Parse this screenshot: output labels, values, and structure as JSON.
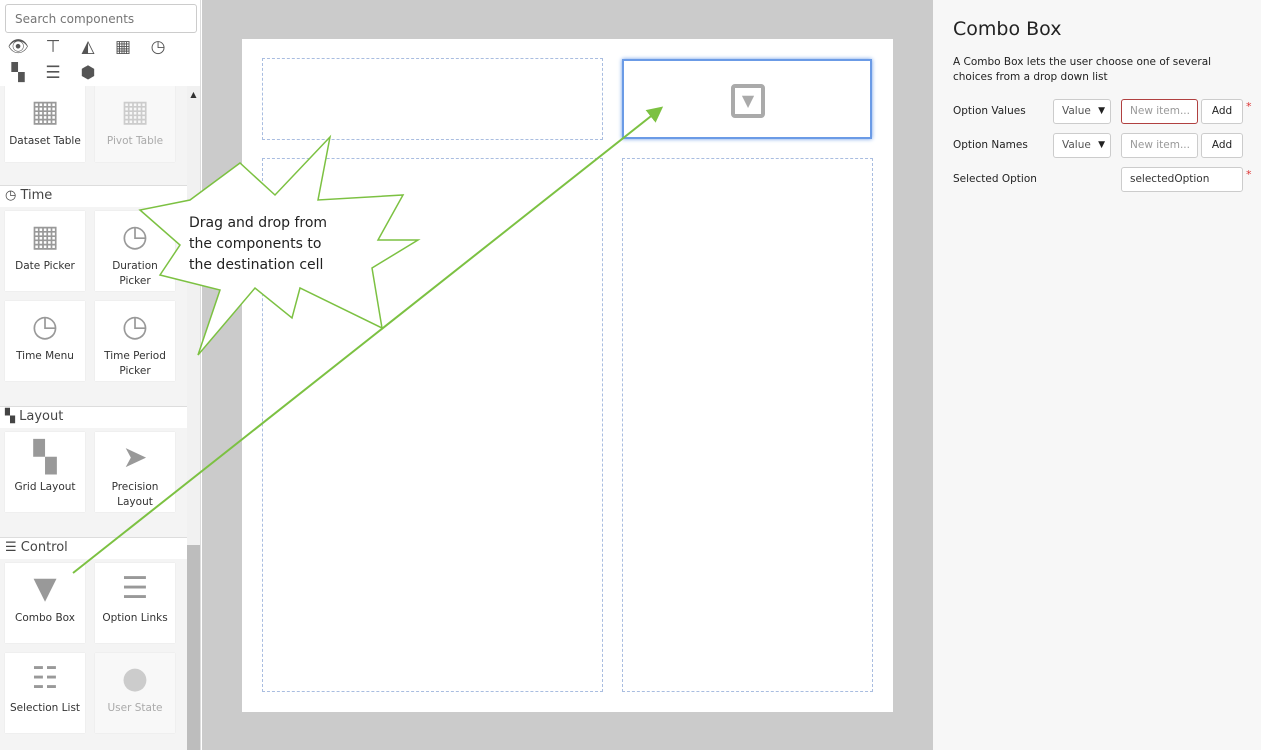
{
  "sidebar": {
    "search_placeholder": "Search components",
    "categories": [
      "eye-icon",
      "hierarchy-icon",
      "area-chart-icon",
      "table-icon",
      "clock-icon",
      "grid-icon",
      "sliders-icon",
      "cube-icon"
    ],
    "sections": {
      "time": "Time",
      "layout": "Layout",
      "control": "Control"
    },
    "tiles": {
      "dataset_table": "Dataset Table",
      "pivot_table": "Pivot Table",
      "date_picker": "Date Picker",
      "duration_picker": "Duration Picker",
      "time_menu": "Time Menu",
      "time_period_picker": "Time Period Picker",
      "grid_layout": "Grid Layout",
      "precision_layout": "Precision Layout",
      "combo_box": "Combo Box",
      "option_links": "Option Links",
      "selection_list": "Selection List",
      "user_state": "User State"
    }
  },
  "callout": {
    "line1": "Drag and drop from",
    "line2": "the components to",
    "line3": "the destination cell"
  },
  "panel": {
    "title": "Combo Box",
    "description": "A Combo Box lets the user choose one of several choices from a drop down list",
    "option_values_label": "Option Values",
    "option_names_label": "Option Names",
    "selected_option_label": "Selected Option",
    "value_select": "Value",
    "new_item_placeholder": "New item...",
    "add": "Add",
    "selected_option_value": "selectedOption",
    "required": "*"
  }
}
